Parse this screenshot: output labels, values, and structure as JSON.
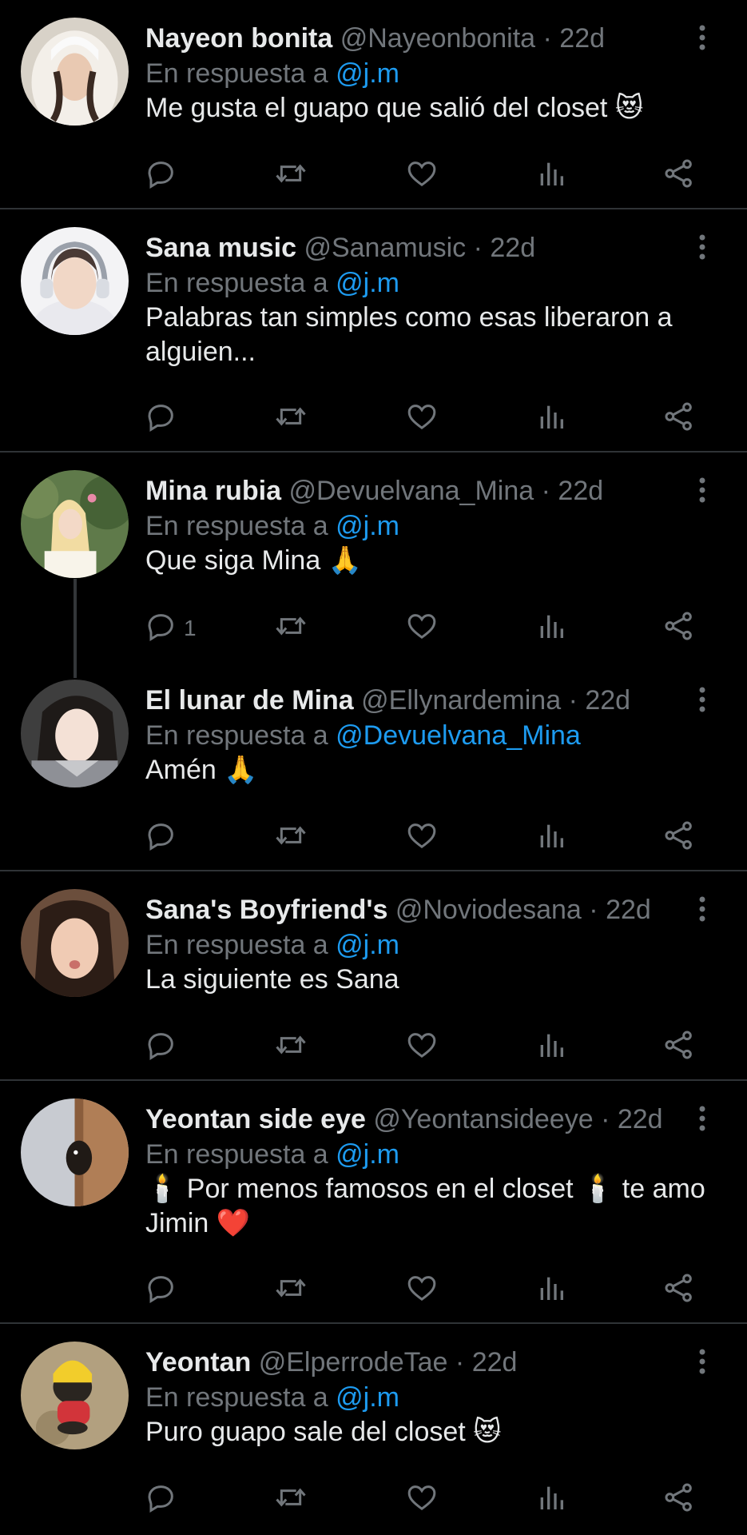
{
  "reply_prefix": "En respuesta a",
  "colors": {
    "background": "#000000",
    "text": "#e7e9ea",
    "muted": "#71767b",
    "link": "#1d9bf0",
    "divider": "#2f3336"
  },
  "action_icons": [
    "reply-icon",
    "retweet-icon",
    "like-icon",
    "views-icon",
    "share-icon"
  ],
  "tweets": [
    {
      "name": "Nayeon bonita",
      "handle": "@Nayeonbonita",
      "time": "22d",
      "reply_to": "@j.m",
      "text": "Me gusta el guapo que salió del closet 😻",
      "reply_count": ""
    },
    {
      "name": "Sana music",
      "handle": "@Sanamusic",
      "time": "22d",
      "reply_to": "@j.m",
      "text": "Palabras tan simples como esas liberaron a alguien...",
      "reply_count": ""
    },
    {
      "name": "Mina rubia",
      "handle": "@Devuelvana_Mina",
      "time": "22d",
      "reply_to": "@j.m",
      "text": "Que siga Mina 🙏",
      "reply_count": "1"
    },
    {
      "name": "El lunar de Mina",
      "handle": "@Ellynardemina",
      "time": "22d",
      "reply_to": "@Devuelvana_Mina",
      "text": "Amén 🙏",
      "reply_count": ""
    },
    {
      "name": "Sana's Boyfriend's",
      "handle": "@Noviodesana",
      "time": "22d",
      "reply_to": "@j.m",
      "text": "La siguiente es Sana",
      "reply_count": ""
    },
    {
      "name": "Yeontan side eye",
      "handle": "@Yeontansideeye",
      "time": "22d",
      "reply_to": "@j.m",
      "text": "🕯️ Por menos famosos en el closet 🕯️ te amo Jimin ❤️",
      "reply_count": ""
    },
    {
      "name": "Yeontan",
      "handle": "@ElperrodeTae",
      "time": "22d",
      "reply_to": "@j.m",
      "text": "Puro guapo sale del closet 😻",
      "reply_count": ""
    }
  ]
}
